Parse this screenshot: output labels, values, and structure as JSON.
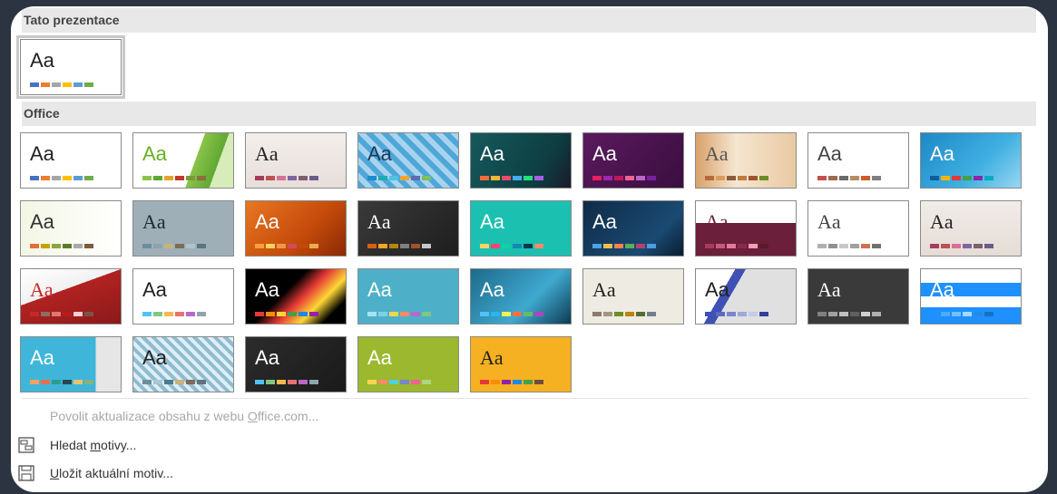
{
  "sections": {
    "this_presentation": "Tato prezentace",
    "office": "Office"
  },
  "sample_text": "Aa",
  "footer": {
    "enable_updates": {
      "pre": "Povolit aktualizace obsahu z webu ",
      "key": "O",
      "post": "ffice.com..."
    },
    "browse": {
      "pre": "Hledat ",
      "key": "m",
      "post": "otivy..."
    },
    "save": {
      "pre": "",
      "key": "U",
      "post": "ložit aktuální motiv..."
    }
  },
  "swatch_default": [
    "#4472c4",
    "#ed7d31",
    "#a5a5a5",
    "#ffc000",
    "#5b9bd5",
    "#70ad47"
  ],
  "themes": [
    {
      "bg": "#ffffff",
      "fg": "#222",
      "swatches": [
        "#4472c4",
        "#ed7d31",
        "#a5a5a5",
        "#ffc000",
        "#5b9bd5",
        "#70ad47"
      ]
    },
    {
      "bg": "linear-gradient(110deg,#ffffff 60%,#8bc34a 60%,#5fa832 80%,#d7ecb9 80%)",
      "fg": "#6ab023",
      "swatches": [
        "#8bc34a",
        "#5fa832",
        "#e6a42a",
        "#c0392b",
        "#7a9a3a",
        "#8e6c3e"
      ]
    },
    {
      "bg": "linear-gradient(180deg,#f3efec 0%,#e7ded9 100%)",
      "fg": "#222",
      "serif": true,
      "swatches": [
        "#a73c5a",
        "#c0504d",
        "#d87093",
        "#8064a2",
        "#7f5f6f",
        "#6b5b8b"
      ]
    },
    {
      "bg": "repeating-linear-gradient(45deg,#4fa7d9 0 6px,#a8d3ee 6px 12px)",
      "fg": "#1c3a5a",
      "swatches": [
        "#1c8bcf",
        "#21a9b4",
        "#4cc3e0",
        "#f0a33a",
        "#5a6fb0",
        "#7fbf5f"
      ]
    },
    {
      "bg": "linear-gradient(120deg,#155a5d 0%,#0d3e42 70%,#1b1b2b 100%)",
      "fg": "#ffffff",
      "swatches": [
        "#f26b3a",
        "#f7b731",
        "#e94b6a",
        "#45aaf2",
        "#26de81",
        "#a55eea"
      ]
    },
    {
      "bg": "linear-gradient(135deg,#5a1a5e 0%,#3a0e3f 100%)",
      "fg": "#ffffff",
      "swatches": [
        "#e91e63",
        "#9c27b0",
        "#c2185b",
        "#f06292",
        "#ba68c8",
        "#7b1fa2"
      ]
    },
    {
      "bg": "linear-gradient(90deg,#d9a16b 0%,#f5e6d0 40%,#e9c9a3 100%)",
      "fg": "#555",
      "serif": true,
      "swatches": [
        "#b66a3b",
        "#d99c5b",
        "#8c5a3a",
        "#c07a3b",
        "#a0522d",
        "#6b8e23"
      ]
    },
    {
      "bg": "#ffffff",
      "fg": "#444",
      "swatches": [
        "#c0504d",
        "#9b6b4a",
        "#6b6b6b",
        "#b78b60",
        "#d05a2a",
        "#7f7f7f"
      ]
    },
    {
      "bg": "linear-gradient(135deg,#1e88c6 0%,#3fb0e2 60%,#9ad6f0 100%)",
      "fg": "#ffffff",
      "swatches": [
        "#0b5e9f",
        "#f4b400",
        "#e53935",
        "#43a047",
        "#8e24aa",
        "#00acc1"
      ]
    },
    {
      "bg": "linear-gradient(90deg,#f3f6e4 0%,#ffffff 100%)",
      "fg": "#333",
      "swatches": [
        "#e36c3a",
        "#c6a000",
        "#8aa63c",
        "#5b7b2a",
        "#a9a9a9",
        "#7b5b3b"
      ]
    },
    {
      "bg": "#9eafb8",
      "fg": "#1b2a35",
      "serif": true,
      "swatches": [
        "#6b8e9e",
        "#8fa3ad",
        "#c9b27c",
        "#7a6b5b",
        "#b0c4ce",
        "#5d7482"
      ]
    },
    {
      "bg": "linear-gradient(135deg,#e87722 0%,#c44a0a 60%,#8a2a05 100%)",
      "fg": "#ffffff",
      "swatches": [
        "#f9a03f",
        "#f4d35e",
        "#ee964b",
        "#d1495b",
        "#c44a0a",
        "#edae49"
      ]
    },
    {
      "bg": "linear-gradient(135deg,#3a3a3a 0%,#1e1e1e 100%)",
      "fg": "#ffffff",
      "serif": true,
      "swatches": [
        "#d95f0e",
        "#f5a623",
        "#b8860b",
        "#7f7f7f",
        "#a0522d",
        "#c8c8c8"
      ]
    },
    {
      "bg": "#1cc0b0",
      "fg": "#ffffff",
      "swatches": [
        "#ffd166",
        "#ef476f",
        "#06d6a0",
        "#118ab2",
        "#073b4c",
        "#f78c6b"
      ]
    },
    {
      "bg": "linear-gradient(135deg,#0f2b47 0%,#1a4a72 70%,#0b1c30 100%)",
      "fg": "#ffffff",
      "swatches": [
        "#4ba3e3",
        "#f2c14e",
        "#f78154",
        "#5fad56",
        "#b4436c",
        "#4d9de0"
      ]
    },
    {
      "bg": "linear-gradient(180deg,#ffffff 40%,#6b1f3a 40%)",
      "fg": "#6b1f3a",
      "serif": true,
      "swatches": [
        "#a83a5e",
        "#c75b7a",
        "#e07b9a",
        "#8a2a4a",
        "#f0a0b0",
        "#5a1a2e"
      ]
    },
    {
      "bg": "#ffffff",
      "fg": "#444",
      "serif": true,
      "swatches": [
        "#b0b0b0",
        "#909090",
        "#c8c8c8",
        "#a0a0a0",
        "#d07050",
        "#707070"
      ]
    },
    {
      "bg": "linear-gradient(180deg,#f1ece8 0%,#e5dcd6 100%)",
      "fg": "#222",
      "serif": true,
      "swatches": [
        "#a73c5a",
        "#c0504d",
        "#d87093",
        "#8064a2",
        "#7f5f6f",
        "#6b5b8b"
      ]
    },
    {
      "bg": "linear-gradient(160deg,#ffffff 0%,#f1f1f1 40%,#b22222 40%,#8b1a1a 100%)",
      "fg": "#c62828",
      "serif": true,
      "swatches": [
        "#c62828",
        "#8d6e63",
        "#e57373",
        "#b71c1c",
        "#ffcdd2",
        "#795548"
      ]
    },
    {
      "bg": "#ffffff",
      "fg": "#222",
      "swatches": [
        "#4fc3f7",
        "#81c784",
        "#ffb74d",
        "#e57373",
        "#ba68c8",
        "#90a4ae"
      ]
    },
    {
      "bg": "linear-gradient(135deg,#000000 40%,#e53935 55%,#fdd835 70%,#000000 85%)",
      "fg": "#ffffff",
      "swatches": [
        "#e53935",
        "#fb8c00",
        "#fdd835",
        "#43a047",
        "#1e88e5",
        "#8e24aa"
      ]
    },
    {
      "bg": "#4db0c8",
      "fg": "#ffffff",
      "swatches": [
        "#a6e3f0",
        "#7fd1e3",
        "#ffd54f",
        "#ff8a65",
        "#ba68c8",
        "#81c784"
      ]
    },
    {
      "bg": "linear-gradient(135deg,#1e6a8a 0%,#3fa9d0 60%,#0d3a52 100%)",
      "fg": "#ffffff",
      "swatches": [
        "#4fc3f7",
        "#29b6f6",
        "#ffee58",
        "#ff7043",
        "#66bb6a",
        "#ab47bc"
      ]
    },
    {
      "bg": "#eeebe2",
      "fg": "#222",
      "serif": true,
      "swatches": [
        "#8c7b6b",
        "#a39584",
        "#6b8e23",
        "#b8860b",
        "#556b2f",
        "#708090"
      ]
    },
    {
      "bg": "linear-gradient(120deg,#ffffff 30%,#3f51b5 30%,#3f51b5 38%,#e0e0e0 38%)",
      "fg": "#222",
      "swatches": [
        "#3f51b5",
        "#5c6bc0",
        "#7986cb",
        "#9fa8da",
        "#c5cae9",
        "#303f9f"
      ]
    },
    {
      "bg": "#3a3a3a",
      "fg": "#ffffff",
      "serif": true,
      "swatches": [
        "#808080",
        "#a0a0a0",
        "#c0c0c0",
        "#606060",
        "#d0d0d0",
        "#b0b0b0"
      ]
    },
    {
      "bg": "linear-gradient(180deg,#ffffff 25%,#1e90ff 25%,#1e90ff 50%,#ffffff 50%,#ffffff 70%,#1e90ff 70%)",
      "fg": "#ffffff",
      "swatches": [
        "#1e90ff",
        "#4dabf7",
        "#74c0fc",
        "#a5d8ff",
        "#228be6",
        "#1971c2"
      ]
    },
    {
      "bg": "linear-gradient(90deg,#3fb6d9 0%,#3fb6d9 75%,#e6e6e6 75%)",
      "fg": "#ffffff",
      "swatches": [
        "#f4a261",
        "#e76f51",
        "#2a9d8f",
        "#264653",
        "#e9c46a",
        "#8ab17d"
      ]
    },
    {
      "bg": "repeating-linear-gradient(45deg,#8fbcd0 0 4px,#dfeef5 4px 8px)",
      "fg": "#222",
      "swatches": [
        "#6b8e9e",
        "#a9c7d6",
        "#4a7a8c",
        "#c9b27c",
        "#7a6b5b",
        "#5d7482"
      ]
    },
    {
      "bg": "linear-gradient(135deg,#2c2c2c 0%,#1a1a1a 100%)",
      "fg": "#ffffff",
      "swatches": [
        "#4fc3f7",
        "#81c784",
        "#ffb74d",
        "#e57373",
        "#ba68c8",
        "#90a4ae"
      ]
    },
    {
      "bg": "#9bb82f",
      "fg": "#ffffff",
      "swatches": [
        "#ffd54f",
        "#ff8a65",
        "#4dd0e1",
        "#7986cb",
        "#f06292",
        "#aed581"
      ]
    },
    {
      "bg": "#f5b121",
      "fg": "#222",
      "serif": true,
      "swatches": [
        "#e53935",
        "#fb8c00",
        "#8e24aa",
        "#1e88e5",
        "#43a047",
        "#6d4c41"
      ]
    }
  ]
}
